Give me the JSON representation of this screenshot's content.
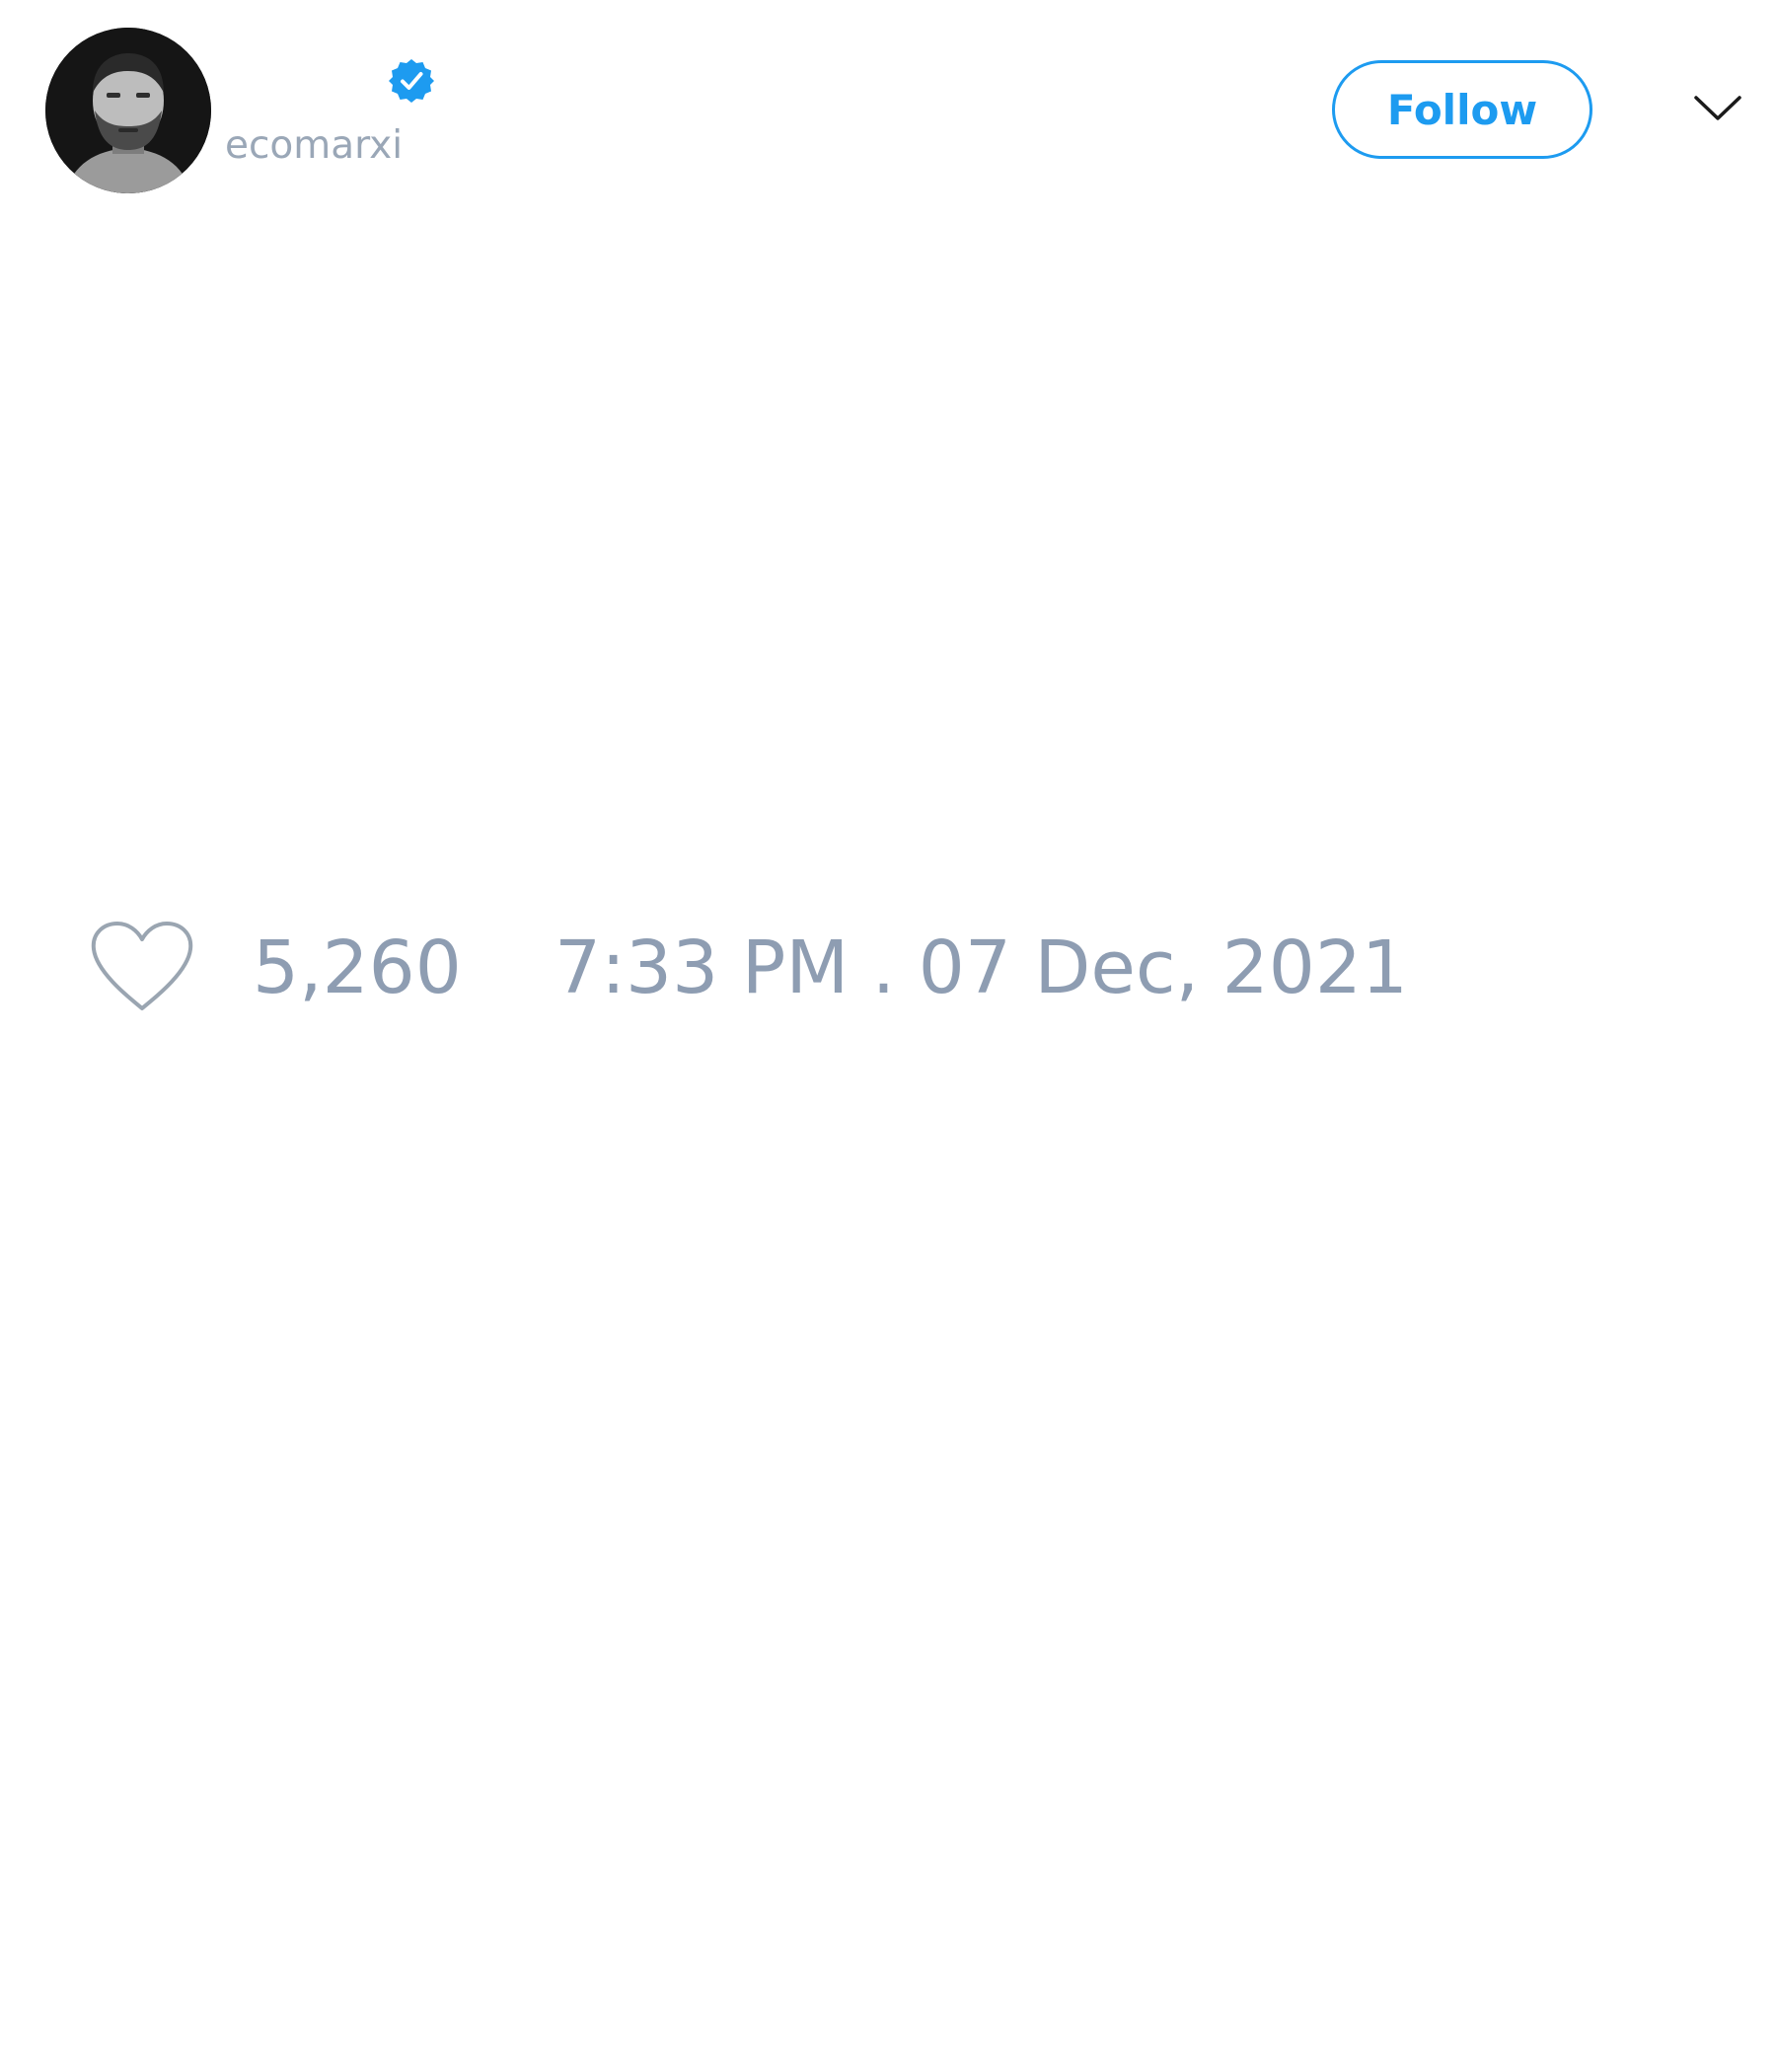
{
  "tweet": {
    "author": {
      "handle": "ecomarxi",
      "verified": true,
      "avatar": "profile-photo"
    },
    "follow_button_label": "Follow",
    "menu_icon": "chevron-down-icon",
    "likes": {
      "icon": "heart-icon",
      "count": "5,260"
    },
    "timestamp": "7:33 PM . 07 Dec, 2021"
  },
  "colors": {
    "accent": "#1d9bf0",
    "muted_text": "#8e9db2",
    "handle_text": "#9aa7b7",
    "icon_stroke": "#9aa5b1"
  }
}
